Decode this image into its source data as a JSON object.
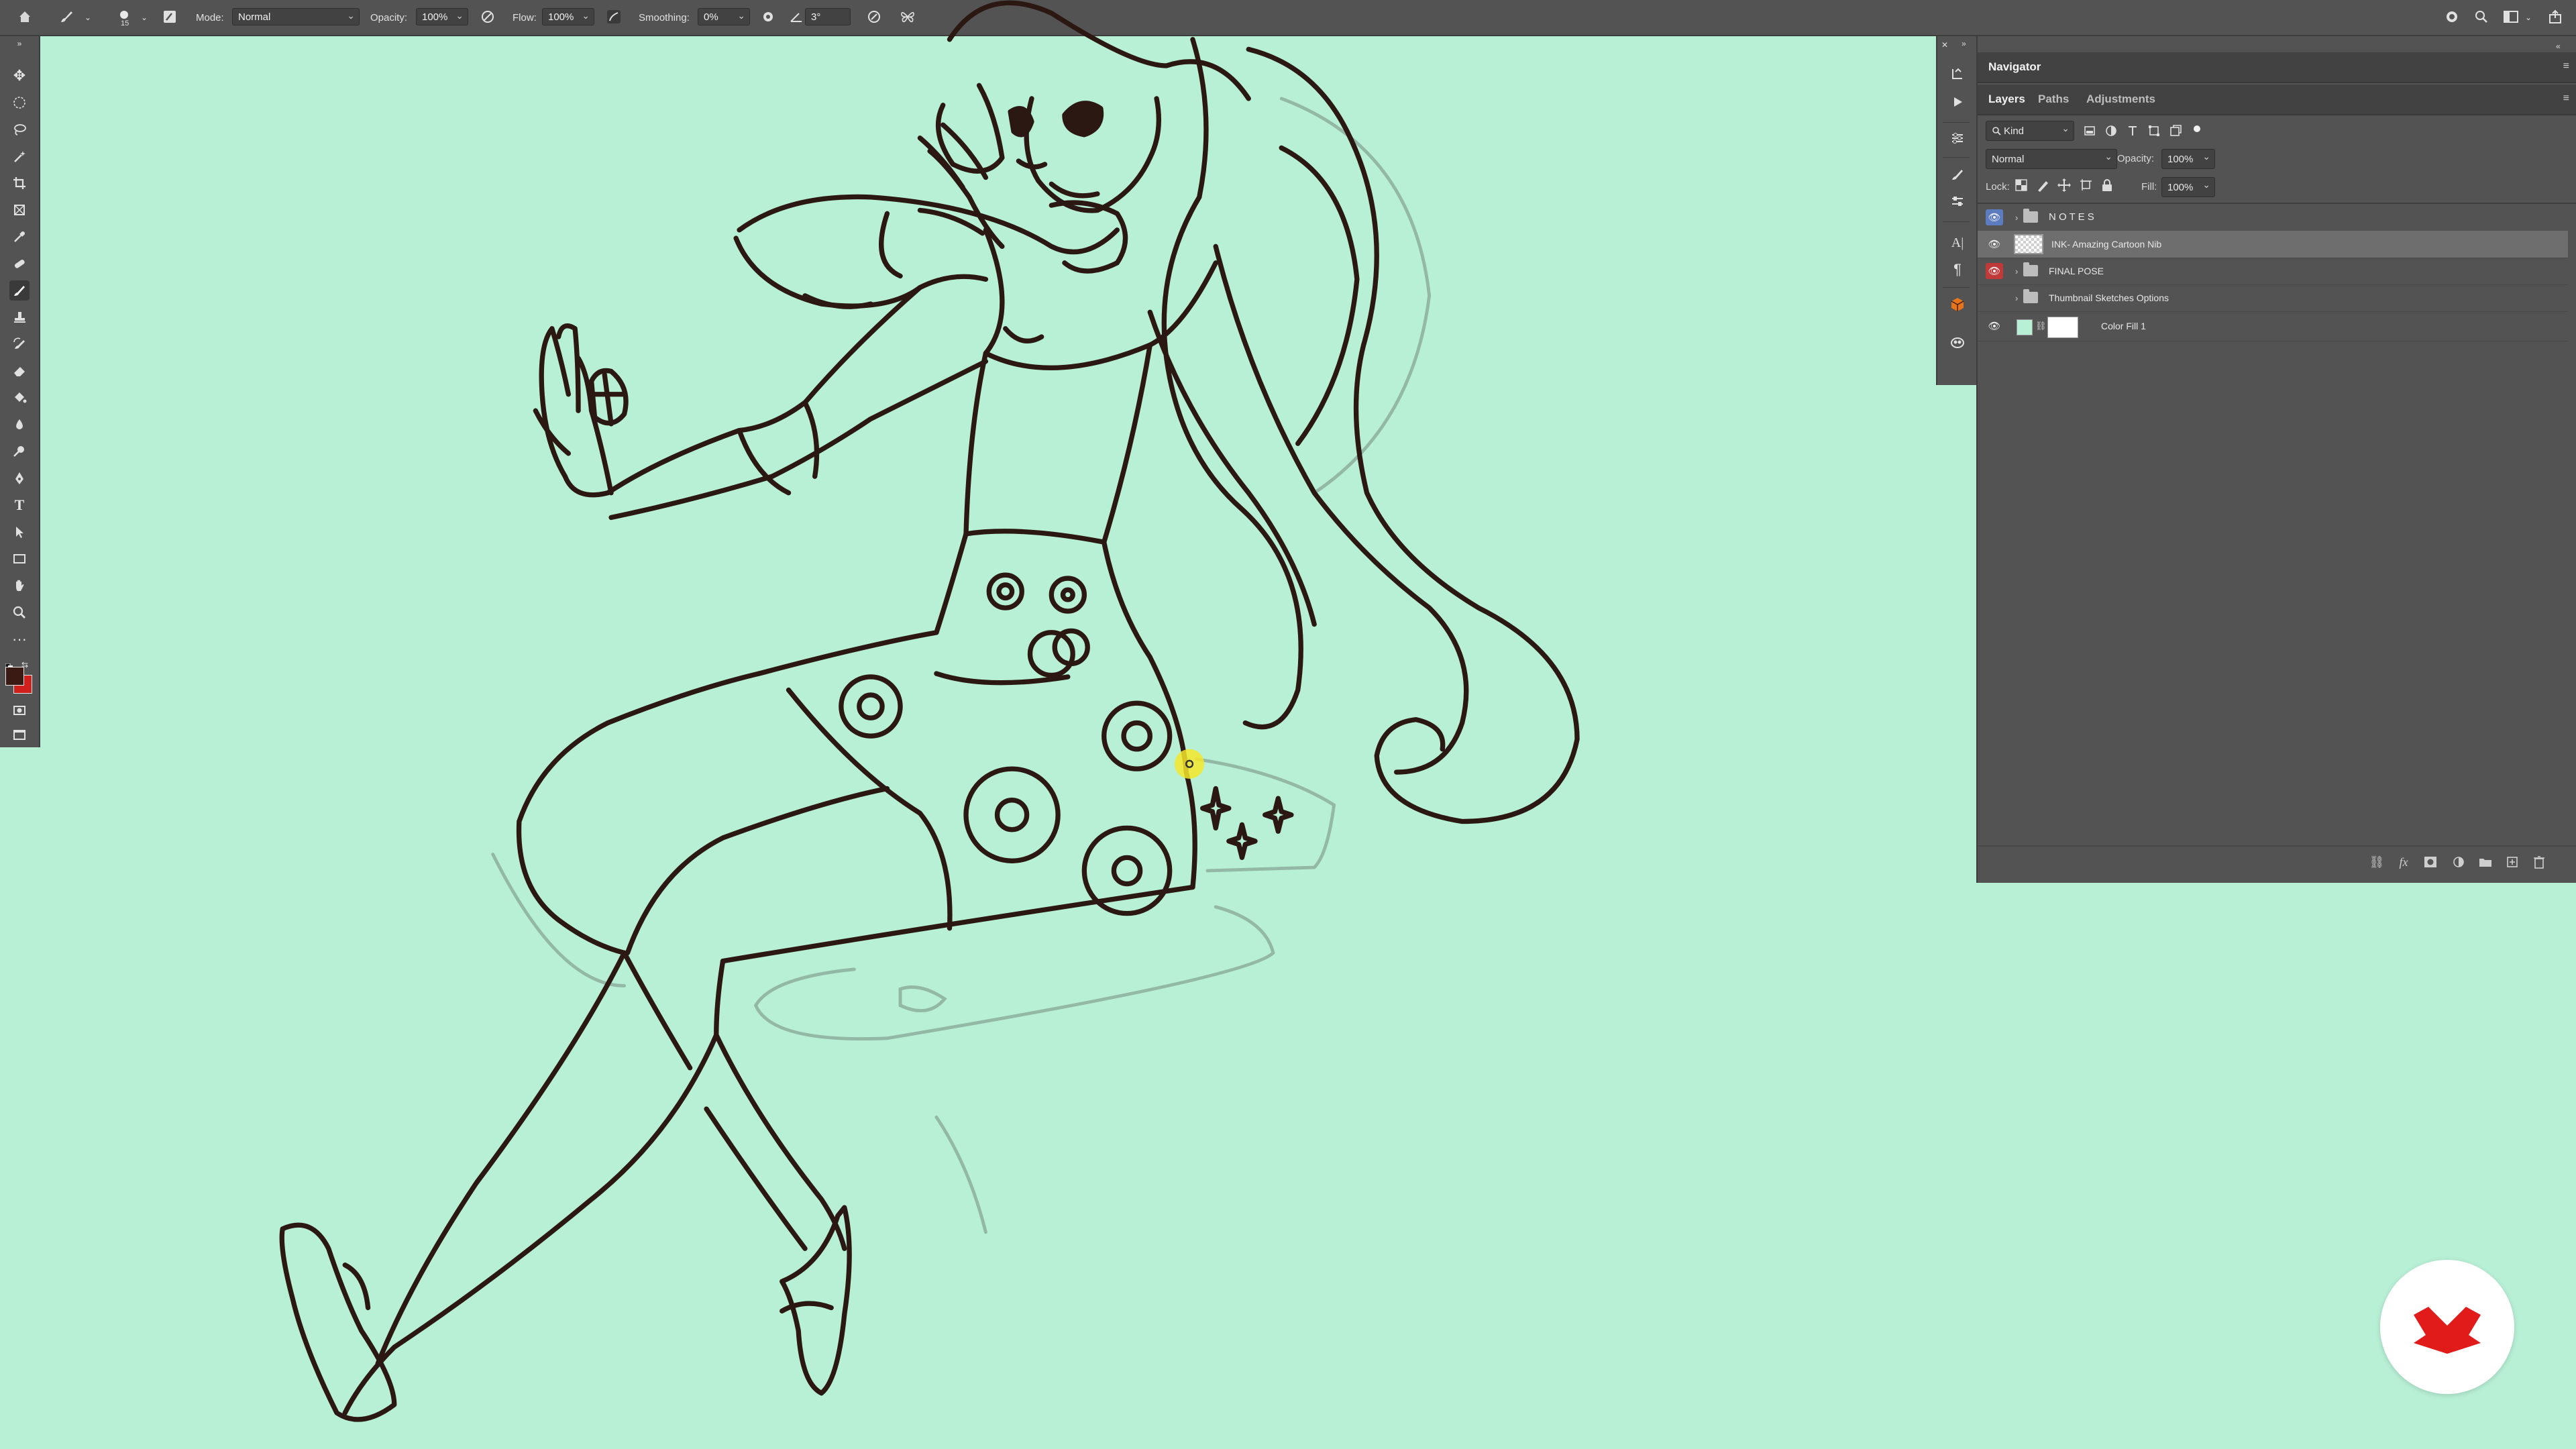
{
  "options_bar": {
    "mode_label": "Mode:",
    "mode_value": "Normal",
    "opacity_label": "Opacity:",
    "opacity_value": "100%",
    "flow_label": "Flow:",
    "flow_value": "100%",
    "smoothing_label": "Smoothing:",
    "smoothing_value": "0%",
    "angle_value": "3°",
    "brush_size": "15"
  },
  "toolbar": {
    "tools": [
      "move-icon",
      "marquee-icon",
      "lasso-icon",
      "magic-wand-icon",
      "crop-icon",
      "frame-icon",
      "eyedropper-icon",
      "healing-icon",
      "brush-icon",
      "stamp-icon",
      "history-brush-icon",
      "eraser-icon",
      "paint-bucket-icon",
      "blur-icon",
      "dodge-icon",
      "pen-icon",
      "type-icon",
      "path-select-icon",
      "rectangle-icon",
      "hand-icon",
      "zoom-icon",
      "more-icon"
    ],
    "active_tool": "brush-icon",
    "foreground_color": "#3a1a12",
    "background_color": "#d0201b"
  },
  "navigator": {
    "title": "Navigator"
  },
  "layers_panel": {
    "tabs": [
      "Layers",
      "Paths",
      "Adjustments"
    ],
    "active_tab": "Layers",
    "filter_kind": "Kind",
    "blend_mode": "Normal",
    "opacity_label": "Opacity:",
    "opacity_value": "100%",
    "lock_label": "Lock:",
    "fill_label": "Fill:",
    "fill_value": "100%",
    "layers": [
      {
        "name": "N O T E S",
        "type": "group",
        "visible": true,
        "eye_color": "#5c7cbf"
      },
      {
        "name": "INK- Amazing Cartoon Nib",
        "type": "pixel",
        "visible": true,
        "selected": true
      },
      {
        "name": "FINAL POSE",
        "type": "group",
        "visible": true,
        "eye_color": "#c03a3a"
      },
      {
        "name": "Thumbnail Sketches Options",
        "type": "group",
        "visible": false
      },
      {
        "name": "Color Fill 1",
        "type": "fill",
        "visible": true,
        "fill_color": "#b8f0d6"
      }
    ]
  },
  "canvas": {
    "background_color": "#b8f0d6",
    "cursor_color": "#f5e62a"
  }
}
